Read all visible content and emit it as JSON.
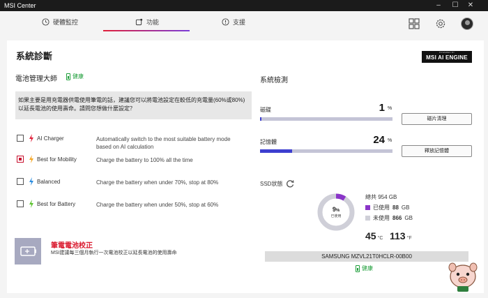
{
  "window": {
    "title": "MSI Center",
    "controls": [
      "–",
      "☐",
      "✕"
    ]
  },
  "tabs": [
    {
      "label": "硬體監控",
      "icon": "monitor-icon"
    },
    {
      "label": "功能",
      "icon": "features-icon",
      "active": true
    },
    {
      "label": "支援",
      "icon": "support-icon"
    }
  ],
  "page": {
    "title": "系統診斷",
    "badge": "MSI AI ENGINE",
    "badge_top": "POWERED BY"
  },
  "battery": {
    "section_title": "電池管理大師",
    "health": "健康",
    "notice": "如果主要是用充電器供電使用筆電的話，建議您可以將電池設定在較低的充電量(60%或80%)以延長電池的使用壽命。請問您想做什麼設定？",
    "modes": [
      {
        "name": "AI Charger",
        "desc": "Automatically switch to the most suitable battery mode based on AI calculation",
        "checked": false,
        "bolt_color": "#e0203a"
      },
      {
        "name": "Best for Mobility",
        "desc": "Charge the battery to 100% all the time",
        "checked": true,
        "bolt_color": "#f5a623"
      },
      {
        "name": "Balanced",
        "desc": "Charge the battery when under 70%, stop at 80%",
        "checked": false,
        "bolt_color": "#2b8de0"
      },
      {
        "name": "Best for Battery",
        "desc": "Charge the battery when under 50%, stop at 60%",
        "checked": false,
        "bolt_color": "#5cc22e"
      }
    ],
    "calibration": {
      "title": "筆電電池校正",
      "desc": "MSI建議每三個月執行一次電池校正以延長電池的使用壽命"
    }
  },
  "system_check": {
    "section_title": "系統檢測",
    "disk": {
      "label": "磁碟",
      "value": "1",
      "unit": "%",
      "percent": 1,
      "button": "磁片清理"
    },
    "memory": {
      "label": "記憶體",
      "value": "24",
      "unit": "%",
      "percent": 24,
      "button": "釋放記憶體"
    },
    "ssd": {
      "label": "SSD狀態",
      "used_percent": "9",
      "used_percent_value": 9,
      "percent_unit": "%",
      "used_caption": "已使用",
      "total_label": "總共",
      "total_value": "954 GB",
      "used_label": "已使用",
      "used_value": "88",
      "unused_label": "未使用",
      "unused_value": "866",
      "size_unit": "GB",
      "temp_c": "45",
      "unit_c": "°C",
      "temp_f": "113",
      "unit_f": "°F",
      "model": "SAMSUNG MZVL21T0HCLR-00B00",
      "health": "健康",
      "used_color": "#8a35c8",
      "unused_color": "#cfcfd8"
    }
  },
  "colors": {
    "accent_red": "#d9172c",
    "accent_blue": "#3d3fcf",
    "health_green": "#1e9e3a"
  }
}
